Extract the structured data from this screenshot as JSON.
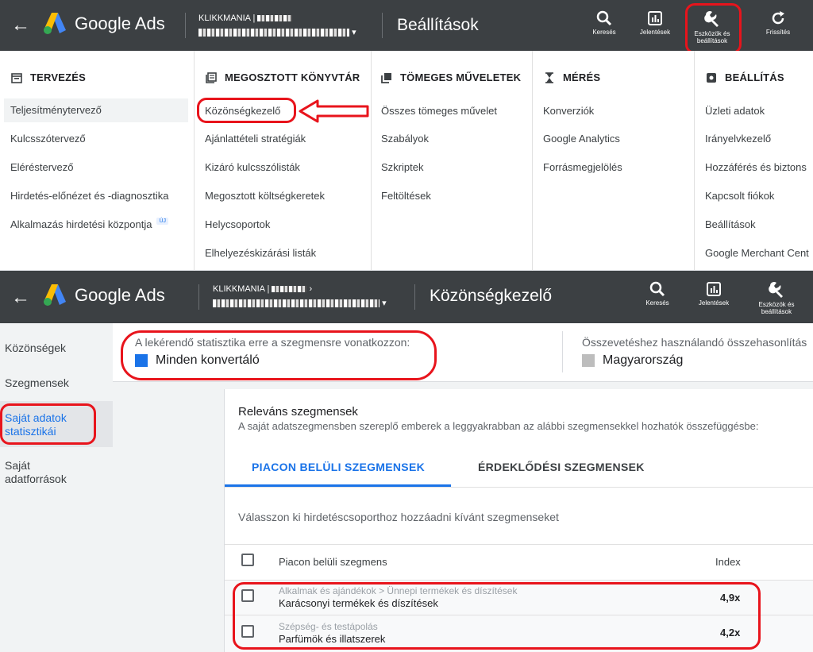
{
  "top1": {
    "logo_text": "Google Ads",
    "account_name": "KLIKKMANIA | ",
    "page_title": "Beállítások",
    "tools": [
      {
        "label": "Keresés",
        "icon": "search-icon"
      },
      {
        "label": "Jelentések",
        "icon": "reports-icon"
      },
      {
        "label": "Eszközök és beállítások",
        "icon": "wrench-icon"
      },
      {
        "label": "Frissítés",
        "icon": "refresh-icon"
      }
    ]
  },
  "menu": {
    "columns": [
      {
        "header": "TERVEZÉS",
        "icon": "calendar-icon",
        "items": [
          "Teljesítménytervező",
          "Kulcsszótervező",
          "Eléréstervező",
          "Hirdetés-előnézet és -diagnosztika",
          "Alkalmazás hirdetési központja"
        ]
      },
      {
        "header": "MEGOSZTOTT KÖNYVTÁR",
        "icon": "library-icon",
        "items": [
          "Közönségkezelő",
          "Ajánlattételi stratégiák",
          "Kizáró kulcsszólisták",
          "Megosztott költségkeretek",
          "Helycsoportok",
          "Elhelyezéskizárási listák"
        ]
      },
      {
        "header": "TÖMEGES MŰVELETEK",
        "icon": "copy-icon",
        "items": [
          "Összes tömeges művelet",
          "Szabályok",
          "Szkriptek",
          "Feltöltések"
        ]
      },
      {
        "header": "MÉRÉS",
        "icon": "hourglass-icon",
        "items": [
          "Konverziók",
          "Google Analytics",
          "Forrásmegjelölés"
        ]
      },
      {
        "header": "BEÁLLÍTÁS",
        "icon": "settings-box-icon",
        "items": [
          "Üzleti adatok",
          "Irányelvkezelő",
          "Hozzáférés és biztons",
          "Kapcsolt fiókok",
          "Beállítások",
          "Google Merchant Cent"
        ]
      }
    ],
    "new_badge": "ÚJ"
  },
  "top2": {
    "logo_text": "Google Ads",
    "account_name": "KLIKKMANIA | ",
    "page_title": "Közönségkezelő",
    "tools": [
      {
        "label": "Keresés",
        "icon": "search-icon"
      },
      {
        "label": "Jelentések",
        "icon": "reports-icon"
      },
      {
        "label": "Eszközök és beállítások",
        "icon": "wrench-icon"
      }
    ]
  },
  "sidebar": {
    "items": [
      "Közönségek",
      "Szegmensek",
      "Saját adatok statisztikái",
      "Saját adatforrások"
    ]
  },
  "stats": {
    "left_label": "A lekérendő statisztika erre a szegmensre vonatkozzon:",
    "left_value": "Minden konvertáló",
    "left_color": "#1a73e8",
    "right_label": "Összevetéshez használandó összehasonlítás",
    "right_value": "Magyarország",
    "right_color": "#bdbdbd"
  },
  "card": {
    "title": "Releváns szegmensek",
    "subtitle": "A saját adatszegmensben szereplő emberek a leggyakrabban az alábbi szegmensekkel hozhatók összefüggésbe:",
    "tabs": [
      "PIACON BELÜLI SZEGMENSEK",
      "ÉRDEKLŐDÉSI SZEGMENSEK"
    ],
    "hint": "Válasszon ki hirdetéscsoporthoz hozzáadni kívánt szegmenseket",
    "col_segment": "Piacon belüli szegmens",
    "col_index": "Index",
    "rows": [
      {
        "category": "Alkalmak és ajándékok > Ünnepi termékek és díszítések",
        "name": "Karácsonyi termékek és díszítések",
        "index": "4,9x"
      },
      {
        "category": "Szépség- és testápolás",
        "name": "Parfümök és illatszerek",
        "index": "4,2x"
      }
    ]
  }
}
